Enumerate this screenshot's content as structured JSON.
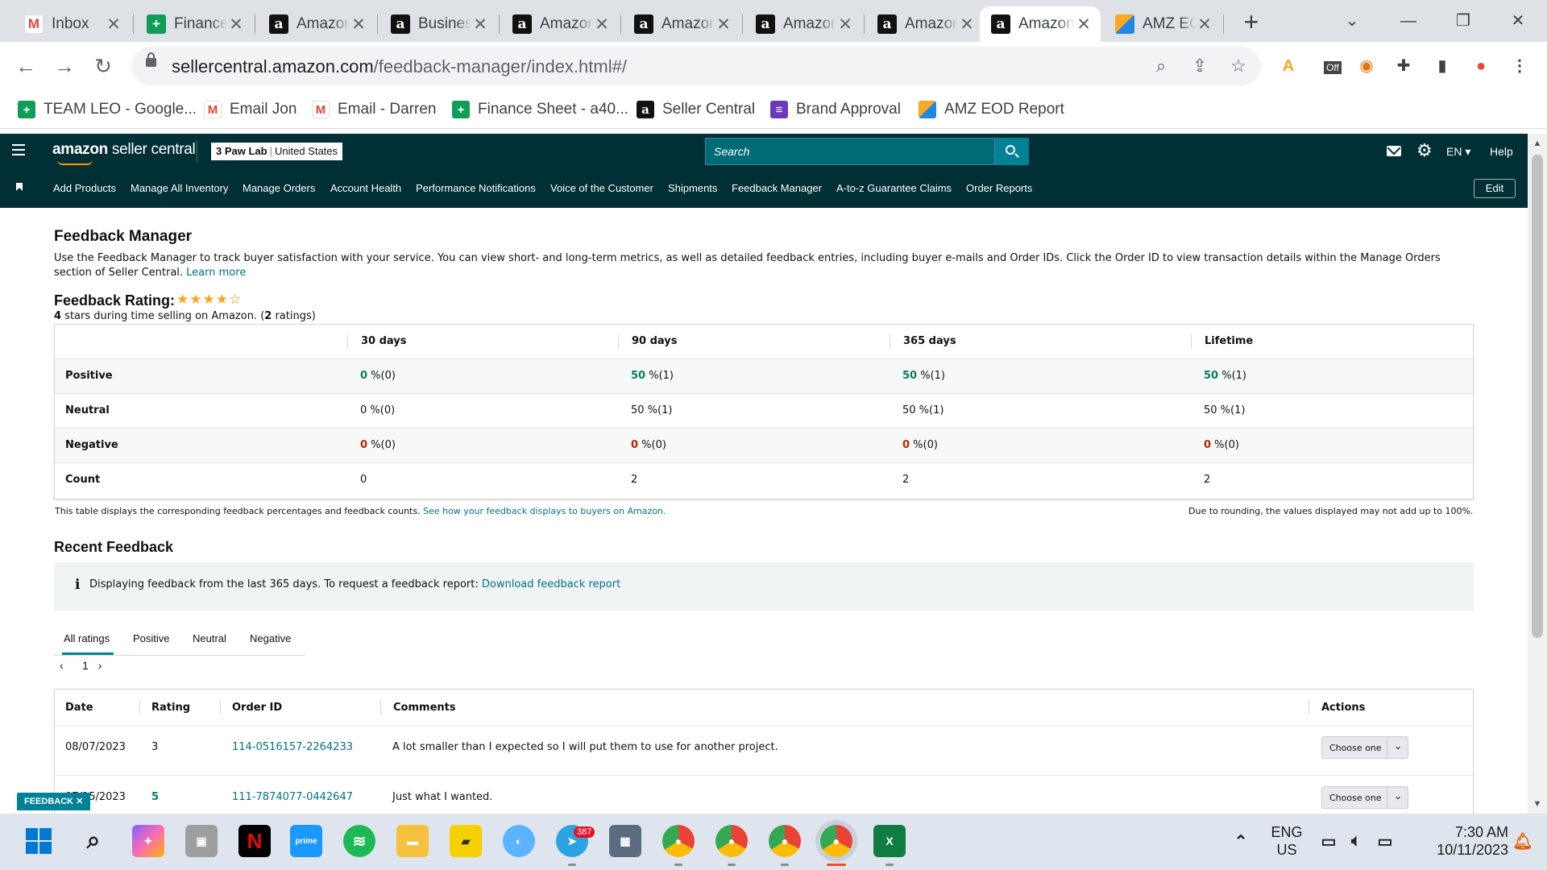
{
  "browser": {
    "tabs": [
      {
        "label": "Inbox",
        "icon": "gmail-icon",
        "close": "✕"
      },
      {
        "label": "Finance",
        "icon": "sheets-icon",
        "close": "✕"
      },
      {
        "label": "Amazon",
        "icon": "amazon-icon",
        "close": "✕"
      },
      {
        "label": "Business",
        "icon": "amazon-icon",
        "close": "✕"
      },
      {
        "label": "Amazon",
        "icon": "amazon-icon",
        "close": "✕"
      },
      {
        "label": "Amazon",
        "icon": "amazon-icon",
        "close": "✕"
      },
      {
        "label": "Amazon",
        "icon": "amazon-icon",
        "close": "✕"
      },
      {
        "label": "Amazon",
        "icon": "amazon-icon",
        "close": "✕"
      },
      {
        "label": "Amazon",
        "icon": "amazon-icon",
        "close": "✕",
        "active": true
      },
      {
        "label": "AMZ EOD",
        "icon": "amz-icon",
        "close": "✕"
      }
    ],
    "new_tab": "+",
    "url_domain": "sellercentral.amazon.com",
    "url_path": "/feedback-manager/index.html#/",
    "bookmarks": [
      {
        "label": "TEAM LEO - Google...",
        "icon": "sheets-icon"
      },
      {
        "label": "Email Jon",
        "icon": "gmail-icon"
      },
      {
        "label": "Email - Darren",
        "icon": "gmail-icon"
      },
      {
        "label": "Finance Sheet - a40...",
        "icon": "sheets-icon"
      },
      {
        "label": "Seller Central",
        "icon": "amazon-icon"
      },
      {
        "label": "Brand Approval",
        "icon": "forms-icon"
      },
      {
        "label": "AMZ EOD Report",
        "icon": "amz-icon"
      }
    ],
    "ext_off_label": "Off"
  },
  "header": {
    "logo_amazon": "amazon",
    "logo_suffix": " seller central",
    "store_name": "3 Paw Lab",
    "store_sep": "|",
    "store_market": "United States",
    "search_placeholder": "Search",
    "language": "EN ▾",
    "help": "Help"
  },
  "nav": {
    "links": [
      "Add Products",
      "Manage All Inventory",
      "Manage Orders",
      "Account Health",
      "Performance Notifications",
      "Voice of the Customer",
      "Shipments",
      "Feedback Manager",
      "A-to-z Guarantee Claims",
      "Order Reports"
    ],
    "edit": "Edit"
  },
  "feedback_manager": {
    "title": "Feedback Manager",
    "description": "Use the Feedback Manager to track buyer satisfaction with your service. You can view short- and long-term metrics, as well as detailed feedback entries, including buyer e-mails and Order IDs. Click the Order ID to view transaction details within the Manage Orders section of Seller Central.",
    "learn_more": "Learn more",
    "rating_title": "Feedback Rating:",
    "stars": "★★★★",
    "stars_empty": "☆",
    "rating_stars": "4",
    "rating_sub_mid": " stars during time selling on Amazon. (",
    "rating_count": "2",
    "rating_sub_end": " ratings)"
  },
  "metrics": {
    "columns": [
      "30 days",
      "90 days",
      "365 days",
      "Lifetime"
    ],
    "rows": [
      {
        "label": "Positive",
        "cells": [
          [
            "0",
            " %(0)"
          ],
          [
            "50",
            " %(1)"
          ],
          [
            "50",
            " %(1)"
          ],
          [
            "50",
            " %(1)"
          ]
        ],
        "style": "pos"
      },
      {
        "label": "Neutral",
        "cells": [
          [
            "0",
            " %(0)"
          ],
          [
            "50",
            " %(1)"
          ],
          [
            "50",
            " %(1)"
          ],
          [
            "50",
            " %(1)"
          ]
        ],
        "style": "plain"
      },
      {
        "label": "Negative",
        "cells": [
          [
            "0",
            " %(0)"
          ],
          [
            "0",
            " %(0)"
          ],
          [
            "0",
            " %(0)"
          ],
          [
            "0",
            " %(0)"
          ]
        ],
        "style": "neg"
      },
      {
        "label": "Count",
        "cells": [
          [
            "0",
            ""
          ],
          [
            "2",
            ""
          ],
          [
            "2",
            ""
          ],
          [
            "2",
            ""
          ]
        ],
        "style": "plain"
      }
    ],
    "note": "This table displays the corresponding feedback percentages and feedback counts.",
    "note_link": "See how your feedback displays to buyers on Amazon.",
    "rounding_note": "Due to rounding, the values displayed may not add up to 100%."
  },
  "recent": {
    "title": "Recent Feedback",
    "info_icon": "i",
    "info_text": "Displaying feedback from the last 365 days. To request a feedback report: ",
    "info_link": "Download feedback report",
    "tabs": [
      "All ratings",
      "Positive",
      "Neutral",
      "Negative"
    ],
    "pager_prev": "‹",
    "pager_page": "1",
    "pager_next": "›",
    "columns": [
      "Date",
      "Rating",
      "Order ID",
      "Comments",
      "Actions"
    ],
    "rows": [
      {
        "date": "08/07/2023",
        "rating": "3",
        "order_id": "114-0516157-2264233",
        "comment": "A lot smaller than I expected so I will put them to use for another project.",
        "action": "Choose one"
      },
      {
        "date": "07/15/2023",
        "rating": "5",
        "order_id": "111-7874077-0442647",
        "comment": "Just what I wanted.",
        "action": "Choose one"
      }
    ],
    "feedback_pill": "FEEDBACK ✕"
  },
  "taskbar": {
    "telegram_badge": "387",
    "lang_line1": "ENG",
    "lang_line2": "US",
    "time": "7:30 AM",
    "date": "10/11/2023"
  },
  "colors": {
    "header_bg": "#002f36",
    "link": "#007185",
    "positive": "#067d62",
    "negative": "#b12704",
    "star": "#ffa41c"
  }
}
